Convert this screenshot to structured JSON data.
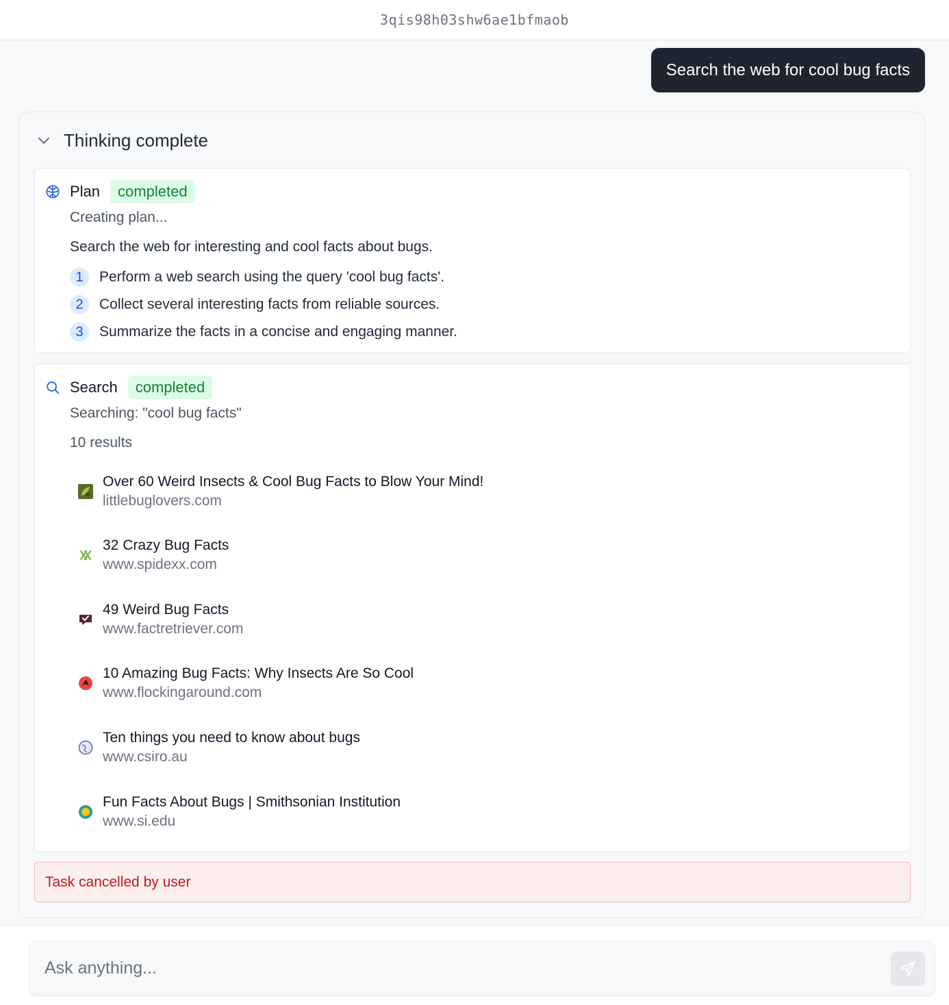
{
  "header": {
    "session_id": "3qis98h03shw6ae1bfmaob"
  },
  "user_message": "Search the web for cool bug facts",
  "thinking": {
    "title": "Thinking complete",
    "plan": {
      "label": "Plan",
      "status": "completed",
      "progress_text": "Creating plan...",
      "summary": "Search the web for interesting and cool facts about bugs.",
      "steps": [
        {
          "num": "1",
          "text": "Perform a web search using the query 'cool bug facts'."
        },
        {
          "num": "2",
          "text": "Collect several interesting facts from reliable sources."
        },
        {
          "num": "3",
          "text": "Summarize the facts in a concise and engaging manner."
        }
      ]
    },
    "search": {
      "label": "Search",
      "status": "completed",
      "query_text": "Searching: \"cool bug facts\"",
      "results_count": "10 results",
      "results": [
        {
          "title": "Over 60 Weird Insects & Cool Bug Facts to Blow Your Mind!",
          "domain": "littlebuglovers.com",
          "favicon": "leaf-favicon-icon"
        },
        {
          "title": "32 Crazy Bug Facts",
          "domain": "www.spidexx.com",
          "favicon": "x-favicon-icon"
        },
        {
          "title": "49 Weird Bug Facts",
          "domain": "www.factretriever.com",
          "favicon": "speech-bubble-favicon-icon"
        },
        {
          "title": "10 Amazing Bug Facts: Why Insects Are So Cool",
          "domain": "www.flockingaround.com",
          "favicon": "bird-favicon-icon"
        },
        {
          "title": "Ten things you need to know about bugs",
          "domain": "www.csiro.au",
          "favicon": "globe-favicon-icon"
        },
        {
          "title": "Fun Facts About Bugs | Smithsonian Institution",
          "domain": "www.si.edu",
          "favicon": "sun-favicon-icon"
        }
      ]
    },
    "cancel_message": "Task cancelled by user"
  },
  "composer": {
    "placeholder": "Ask anything...",
    "send_icon": "send-icon"
  },
  "colors": {
    "accent": "#2563eb",
    "badge_bg": "#dcfce7",
    "badge_text": "#15803d",
    "error_bg": "#fdeeee",
    "error_text": "#b91c1c",
    "user_bubble": "#1e2430"
  }
}
